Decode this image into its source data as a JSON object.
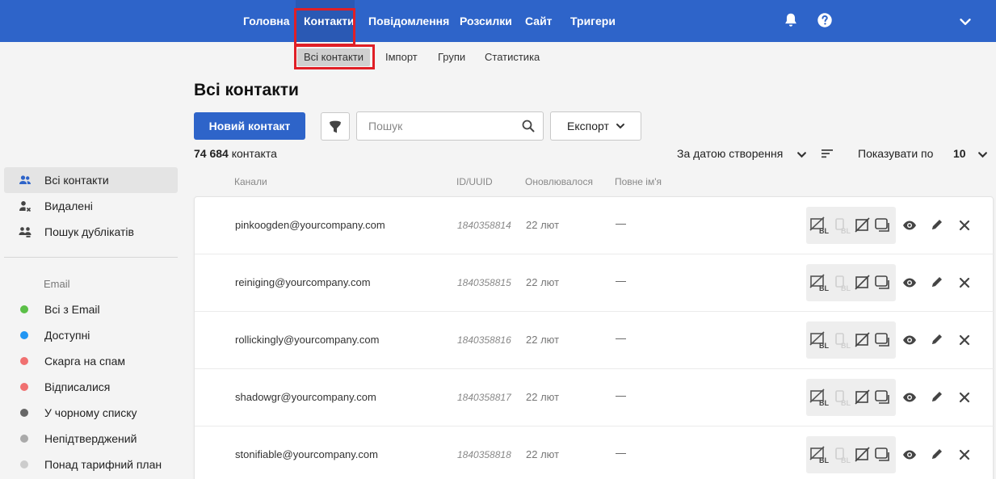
{
  "topnav": {
    "items": [
      {
        "label": "Головна"
      },
      {
        "label": "Контакти"
      },
      {
        "label": "Повідомлення"
      },
      {
        "label": "Розсилки"
      },
      {
        "label": "Сайт"
      },
      {
        "label": "Тригери"
      }
    ],
    "active": "Контакти",
    "icons": [
      "bell-icon",
      "help-icon",
      "chevron-down-icon"
    ]
  },
  "subnav": {
    "items": [
      {
        "label": "Всі контакти"
      },
      {
        "label": "Імпорт"
      },
      {
        "label": "Групи"
      },
      {
        "label": "Статистика"
      }
    ],
    "active": "Всі контакти"
  },
  "sidebar": {
    "items": [
      {
        "label": "Всі контакти",
        "icon": "contacts-icon"
      },
      {
        "label": "Видалені",
        "icon": "user-deleted-icon"
      },
      {
        "label": "Пошук дублікатів",
        "icon": "duplicates-icon"
      }
    ],
    "email_heading": "Email",
    "email_items": [
      {
        "label": "Всі з Email",
        "color": "#5bbf47"
      },
      {
        "label": "Доступні",
        "color": "#2196f3"
      },
      {
        "label": "Скарга на спам",
        "color": "#f07070"
      },
      {
        "label": "Відписалися",
        "color": "#f07070"
      },
      {
        "label": "У чорному списку",
        "color": "#666666"
      },
      {
        "label": "Непідтверджений",
        "color": "#aaaaaa"
      },
      {
        "label": "Понад тарифний план",
        "color": "#cccccc"
      }
    ]
  },
  "main": {
    "title": "Всі контакти",
    "new_contact_label": "Новий контакт",
    "search_placeholder": "Пошук",
    "export_label": "Експорт",
    "count_number": "74 684",
    "count_suffix": "контакта",
    "sort_label": "За датою створення",
    "show_label": "Показувати по",
    "show_value": "10",
    "columns": [
      "Канали",
      "ID/UUID",
      "Оновлювалося",
      "Повне ім'я"
    ],
    "rows": [
      {
        "email": "pinkoogden@yourcompany.com",
        "id": "1840358814",
        "updated": "22 лют",
        "name": "—"
      },
      {
        "email": "reiniging@yourcompany.com",
        "id": "1840358815",
        "updated": "22 лют",
        "name": "—"
      },
      {
        "email": "rollickingly@yourcompany.com",
        "id": "1840358816",
        "updated": "22 лют",
        "name": "—"
      },
      {
        "email": "shadowgr@yourcompany.com",
        "id": "1840358817",
        "updated": "22 лют",
        "name": "—"
      },
      {
        "email": "stonifiable@yourcompany.com",
        "id": "1840358818",
        "updated": "22 лют",
        "name": "—"
      }
    ]
  },
  "colors": {
    "brand": "#2e64c9",
    "highlight": "#e01f26"
  }
}
